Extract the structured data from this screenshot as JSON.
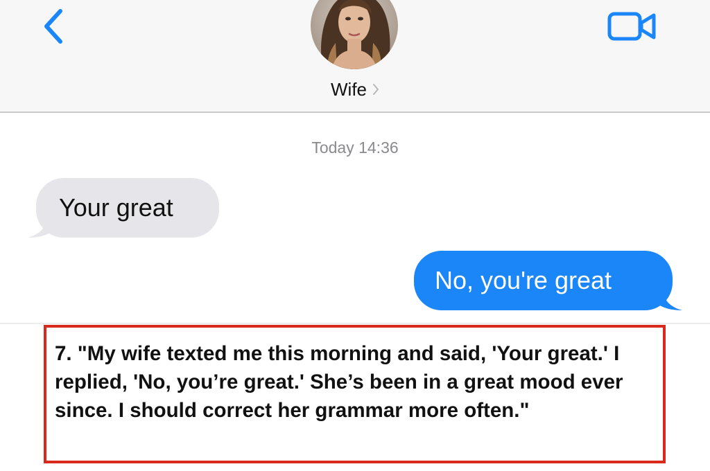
{
  "header": {
    "back_icon": "chevron-left-icon",
    "video_icon": "video-camera-icon",
    "contact_name": "Wife",
    "contact_chevron": ">",
    "accent_color": "#1b86f8"
  },
  "chat": {
    "timestamp": "Today 14:36",
    "messages": [
      {
        "direction": "incoming",
        "text": "Your great"
      },
      {
        "direction": "outgoing",
        "text": "No, you're great"
      }
    ],
    "incoming_color": "#e5e5ea",
    "outgoing_color": "#1b86f8"
  },
  "caption": {
    "text": "7. \"My wife texted me this morning and said, 'Your great.' I replied, 'No, you’re great.' She’s been in a great mood ever since. I should correct her grammar more often.\"",
    "border_color": "#d9291c"
  }
}
